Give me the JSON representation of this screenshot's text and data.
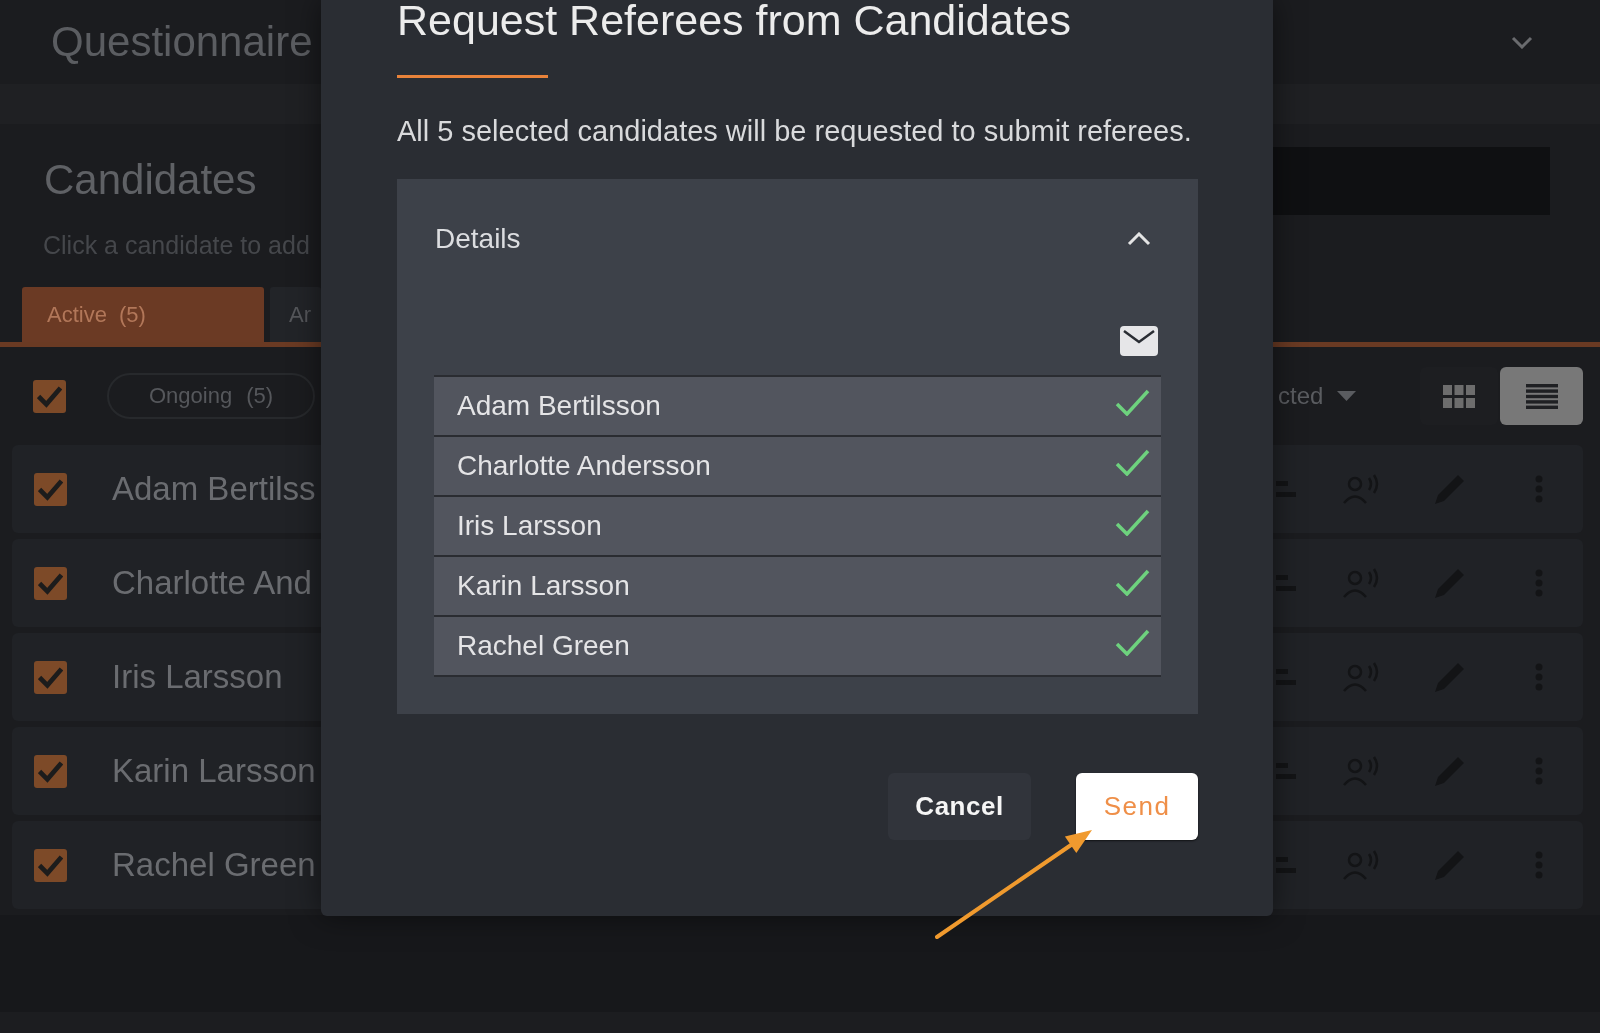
{
  "header": {
    "title": "Questionnaire"
  },
  "candidates": {
    "title": "Candidates",
    "hint": "Click a candidate to add",
    "tabs": [
      {
        "label": "Active",
        "count": "(5)",
        "selected": true
      },
      {
        "label": "Ar",
        "selected": false
      }
    ],
    "select_all": {
      "checked": true
    },
    "status_filter": {
      "label": "Ongoing",
      "count": "(5)"
    },
    "sort": {
      "label": "cted"
    },
    "views": [
      {
        "kind": "grid",
        "selected": false
      },
      {
        "kind": "list",
        "selected": true
      }
    ],
    "rows": [
      {
        "name": "Adam Bertilss",
        "checked": true
      },
      {
        "name": "Charlotte And",
        "checked": true
      },
      {
        "name": "Iris Larsson",
        "checked": true
      },
      {
        "name": "Karin Larsson",
        "checked": true
      },
      {
        "name": "Rachel Green",
        "checked": true
      }
    ]
  },
  "dialog": {
    "title": "Request Referees from Candidates",
    "message": "All 5 selected candidates will be requested to submit referees.",
    "details": {
      "label": "Details",
      "expanded": true,
      "recipients": [
        {
          "name": "Adam Bertilsson",
          "sent": true
        },
        {
          "name": "Charlotte Andersson",
          "sent": true
        },
        {
          "name": "Iris Larsson",
          "sent": true
        },
        {
          "name": "Karin Larsson",
          "sent": true
        },
        {
          "name": "Rachel Green",
          "sent": true
        }
      ]
    },
    "buttons": [
      {
        "kind": "cancel",
        "label": "Cancel"
      },
      {
        "kind": "send",
        "label": "Send"
      }
    ]
  }
}
